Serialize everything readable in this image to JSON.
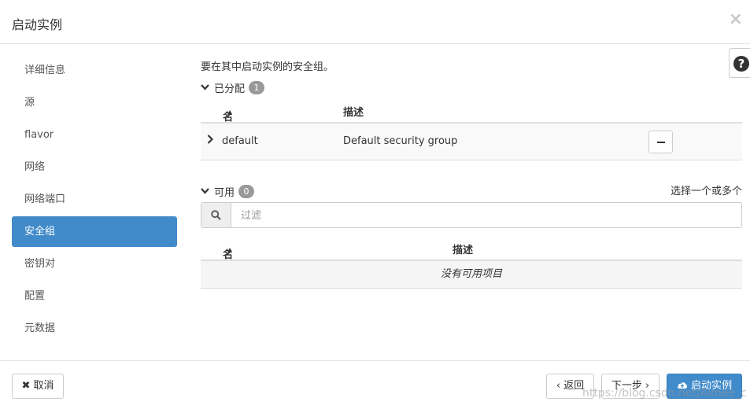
{
  "modal": {
    "title": "启动实例",
    "close_glyph": "×"
  },
  "sidebar": {
    "items": [
      {
        "label": "详细信息"
      },
      {
        "label": "源"
      },
      {
        "label": "flavor"
      },
      {
        "label": "网络"
      },
      {
        "label": "网络端口"
      },
      {
        "label": "安全组",
        "active": true
      },
      {
        "label": "密钥对"
      },
      {
        "label": "配置"
      },
      {
        "label": "元数据"
      }
    ]
  },
  "main": {
    "intro": "要在其中启动实例的安全组。",
    "help_glyph": "?",
    "allocated": {
      "label": "已分配",
      "count": "1",
      "columns": {
        "name": "名称",
        "description": "描述"
      },
      "rows": [
        {
          "name": "default",
          "description": "Default security group"
        }
      ]
    },
    "available": {
      "label": "可用",
      "count": "0",
      "select_hint": "选择一个或多个",
      "filter_placeholder": "过滤",
      "columns": {
        "name": "名称",
        "description": "描述"
      },
      "empty_text": "没有可用项目"
    }
  },
  "footer": {
    "cancel": "取消",
    "back": "返回",
    "next": "下一步",
    "launch": "启动实例"
  },
  "watermark": "https://blog.csdn.net/Aimee_c",
  "colors": {
    "accent": "#428bca",
    "badge": "#999999"
  }
}
